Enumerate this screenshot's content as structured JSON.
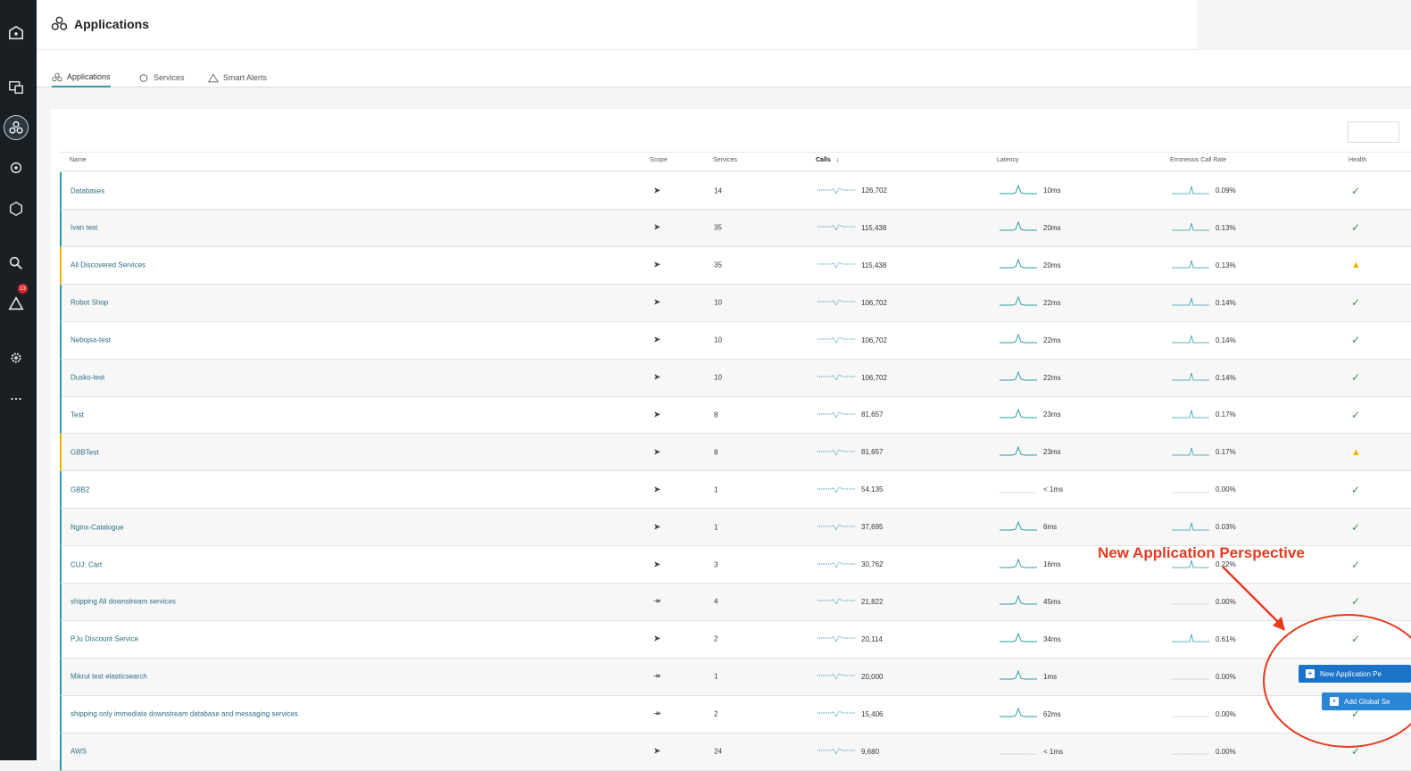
{
  "header": {
    "title": "Applications"
  },
  "tabs": [
    {
      "label": "Applications",
      "icon": "applications-icon",
      "active": true
    },
    {
      "label": "Services",
      "icon": "services-icon",
      "active": false
    },
    {
      "label": "Smart Alerts",
      "icon": "alert-triangle-icon",
      "active": false
    }
  ],
  "sidebar": {
    "items": [
      "home-icon",
      "infrastructure-icon",
      "applications-icon",
      "platforms-icon",
      "websites-icon",
      "analytics-icon",
      "events-icon",
      "settings-icon",
      "more-icon"
    ],
    "alert_badge": "13"
  },
  "table": {
    "columns": {
      "name": "Name",
      "scope": "Scope",
      "services": "Services",
      "calls": "Calls",
      "sort": "↓",
      "latency": "Latency",
      "err": "Erroneous Call Rate",
      "health": "Health"
    },
    "rows": [
      {
        "name": "Databases",
        "scope": "upstream",
        "services": "14",
        "calls": "126,702",
        "latency": "10ms",
        "err": "0.09%",
        "health": "ok"
      },
      {
        "name": "Ivan test",
        "scope": "upstream",
        "services": "35",
        "calls": "115,438",
        "latency": "20ms",
        "err": "0.13%",
        "health": "ok"
      },
      {
        "name": "All Discovered Services",
        "scope": "upstream",
        "services": "35",
        "calls": "115,438",
        "latency": "20ms",
        "err": "0.13%",
        "health": "warning"
      },
      {
        "name": "Robot Shop",
        "scope": "upstream",
        "services": "10",
        "calls": "106,702",
        "latency": "22ms",
        "err": "0.14%",
        "health": "ok"
      },
      {
        "name": "Nebojsa-test",
        "scope": "upstream",
        "services": "10",
        "calls": "106,702",
        "latency": "22ms",
        "err": "0.14%",
        "health": "ok"
      },
      {
        "name": "Dusko-test",
        "scope": "upstream",
        "services": "10",
        "calls": "106,702",
        "latency": "22ms",
        "err": "0.14%",
        "health": "ok"
      },
      {
        "name": "Test",
        "scope": "upstream",
        "services": "8",
        "calls": "81,657",
        "latency": "23ms",
        "err": "0.17%",
        "health": "ok"
      },
      {
        "name": "GBBTest",
        "scope": "upstream",
        "services": "8",
        "calls": "81,657",
        "latency": "23ms",
        "err": "0.17%",
        "health": "warning"
      },
      {
        "name": "GBB2",
        "scope": "upstream",
        "services": "1",
        "calls": "54,135",
        "latency": "< 1ms",
        "err": "0.00%",
        "health": "ok"
      },
      {
        "name": "Nginx-Catalogue",
        "scope": "upstream",
        "services": "1",
        "calls": "37,695",
        "latency": "6ms",
        "err": "0.03%",
        "health": "ok"
      },
      {
        "name": "CUJ: Cart",
        "scope": "upstream",
        "services": "3",
        "calls": "30,762",
        "latency": "16ms",
        "err": "0.22%",
        "health": "ok"
      },
      {
        "name": "shipping All downstream services",
        "scope": "downstream",
        "services": "4",
        "calls": "21,822",
        "latency": "45ms",
        "err": "0.00%",
        "health": "ok"
      },
      {
        "name": "PJu Discount Service",
        "scope": "upstream",
        "services": "2",
        "calls": "20,114",
        "latency": "34ms",
        "err": "0.61%",
        "health": "ok"
      },
      {
        "name": "Mikrut test elasticsearch",
        "scope": "downstream",
        "services": "1",
        "calls": "20,000",
        "latency": "1ms",
        "err": "0.00%",
        "health": "ok"
      },
      {
        "name": "shipping only immediate downstream database and messaging services",
        "scope": "downstream",
        "services": "2",
        "calls": "15,406",
        "latency": "62ms",
        "err": "0.00%",
        "health": "ok"
      },
      {
        "name": "AWS",
        "scope": "upstream",
        "services": "24",
        "calls": "9,680",
        "latency": "< 1ms",
        "err": "0.00%",
        "health": "ok"
      }
    ]
  },
  "annotation": {
    "callout": "New Application Perspective"
  },
  "buttons": {
    "new_app": "New Application Pe",
    "add_global": "Add Global Se"
  },
  "colors": {
    "accent": "#2e9aa8",
    "warning": "#f0b400",
    "ok": "#3a8e4a",
    "callout": "#e53a20",
    "button": "#1a73c9"
  }
}
